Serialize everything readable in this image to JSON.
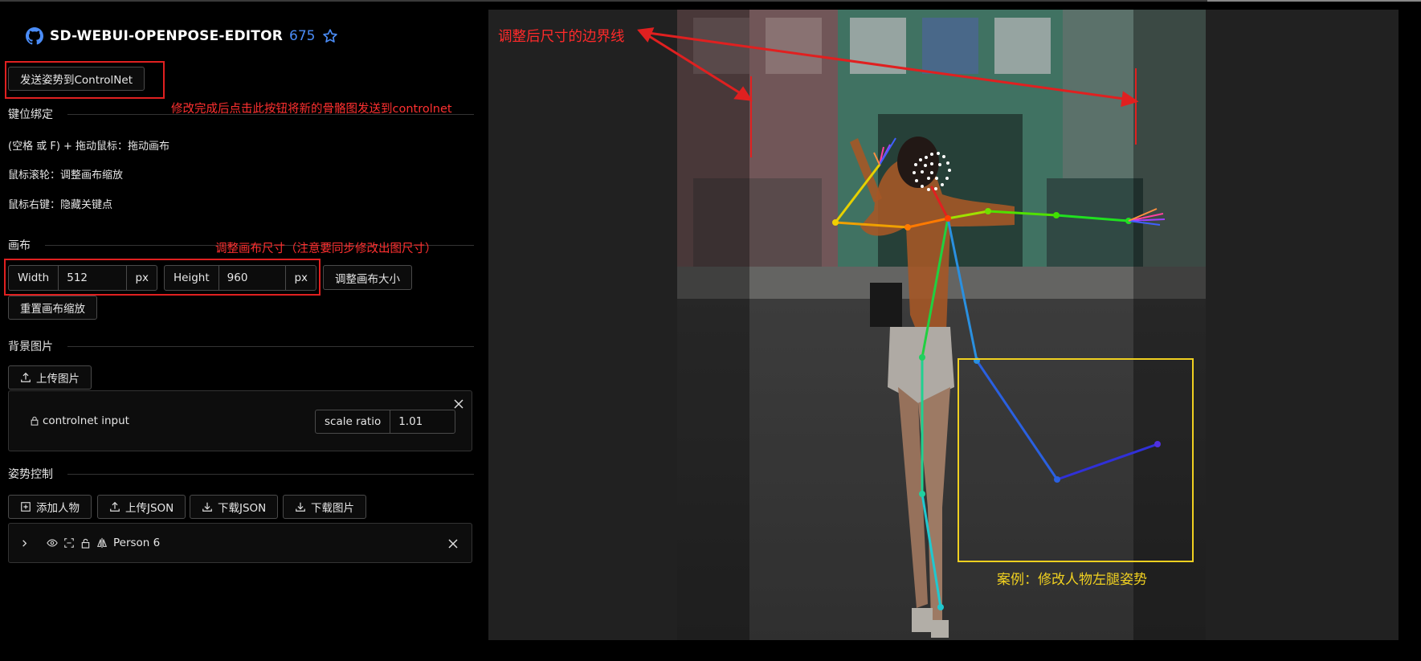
{
  "header": {
    "title": "SD-WEBUI-OPENPOSE-EDITOR",
    "stars": "675"
  },
  "toolbar": {
    "send_button": "发送姿势到ControlNet",
    "send_note": "修改完成后点击此按钮将新的骨骼图发送到controlnet"
  },
  "keybind": {
    "heading": "键位绑定",
    "lines": [
      "(空格 或 F) + 拖动鼠标：拖动画布",
      "鼠标滚轮：调整画布缩放",
      "鼠标右键：隐藏关键点"
    ]
  },
  "canvas": {
    "heading": "画布",
    "note": "调整画布尺寸（注意要同步修改出图尺寸）",
    "width_label": "Width",
    "width_value": "512",
    "height_label": "Height",
    "height_value": "960",
    "unit": "px",
    "resize_button": "调整画布大小",
    "reset_zoom_button": "重置画布缩放"
  },
  "background": {
    "heading": "背景图片",
    "upload_button": "上传图片",
    "item_label": "controlnet input",
    "scale_label": "scale ratio",
    "scale_value": "1.01"
  },
  "pose": {
    "heading": "姿势控制",
    "buttons": [
      "添加人物",
      "上传JSON",
      "下载JSON",
      "下载图片"
    ],
    "person_label": "Person 6"
  },
  "annotations": {
    "boundary_label": "调整后尺寸的边界线",
    "case_label": "案例：修改人物左腿姿势"
  },
  "colors": {
    "accent_red": "#e02020",
    "accent_yellow": "#f0d020",
    "star_blue": "#4a8cf7"
  }
}
